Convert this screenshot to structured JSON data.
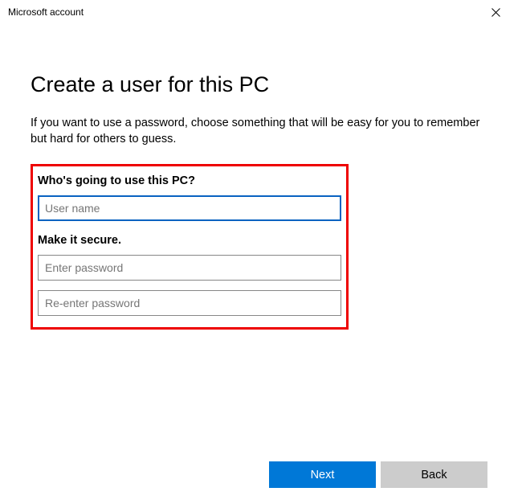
{
  "titlebar": {
    "title": "Microsoft account"
  },
  "page": {
    "heading": "Create a user for this PC",
    "description": "If you want to use a password, choose something that will be easy for you to remember but hard for others to guess."
  },
  "form": {
    "section1_label": "Who's going to use this PC?",
    "username": {
      "placeholder": "User name",
      "value": ""
    },
    "section2_label": "Make it secure.",
    "password": {
      "placeholder": "Enter password",
      "value": ""
    },
    "password_confirm": {
      "placeholder": "Re-enter password",
      "value": ""
    }
  },
  "footer": {
    "next_label": "Next",
    "back_label": "Back"
  }
}
